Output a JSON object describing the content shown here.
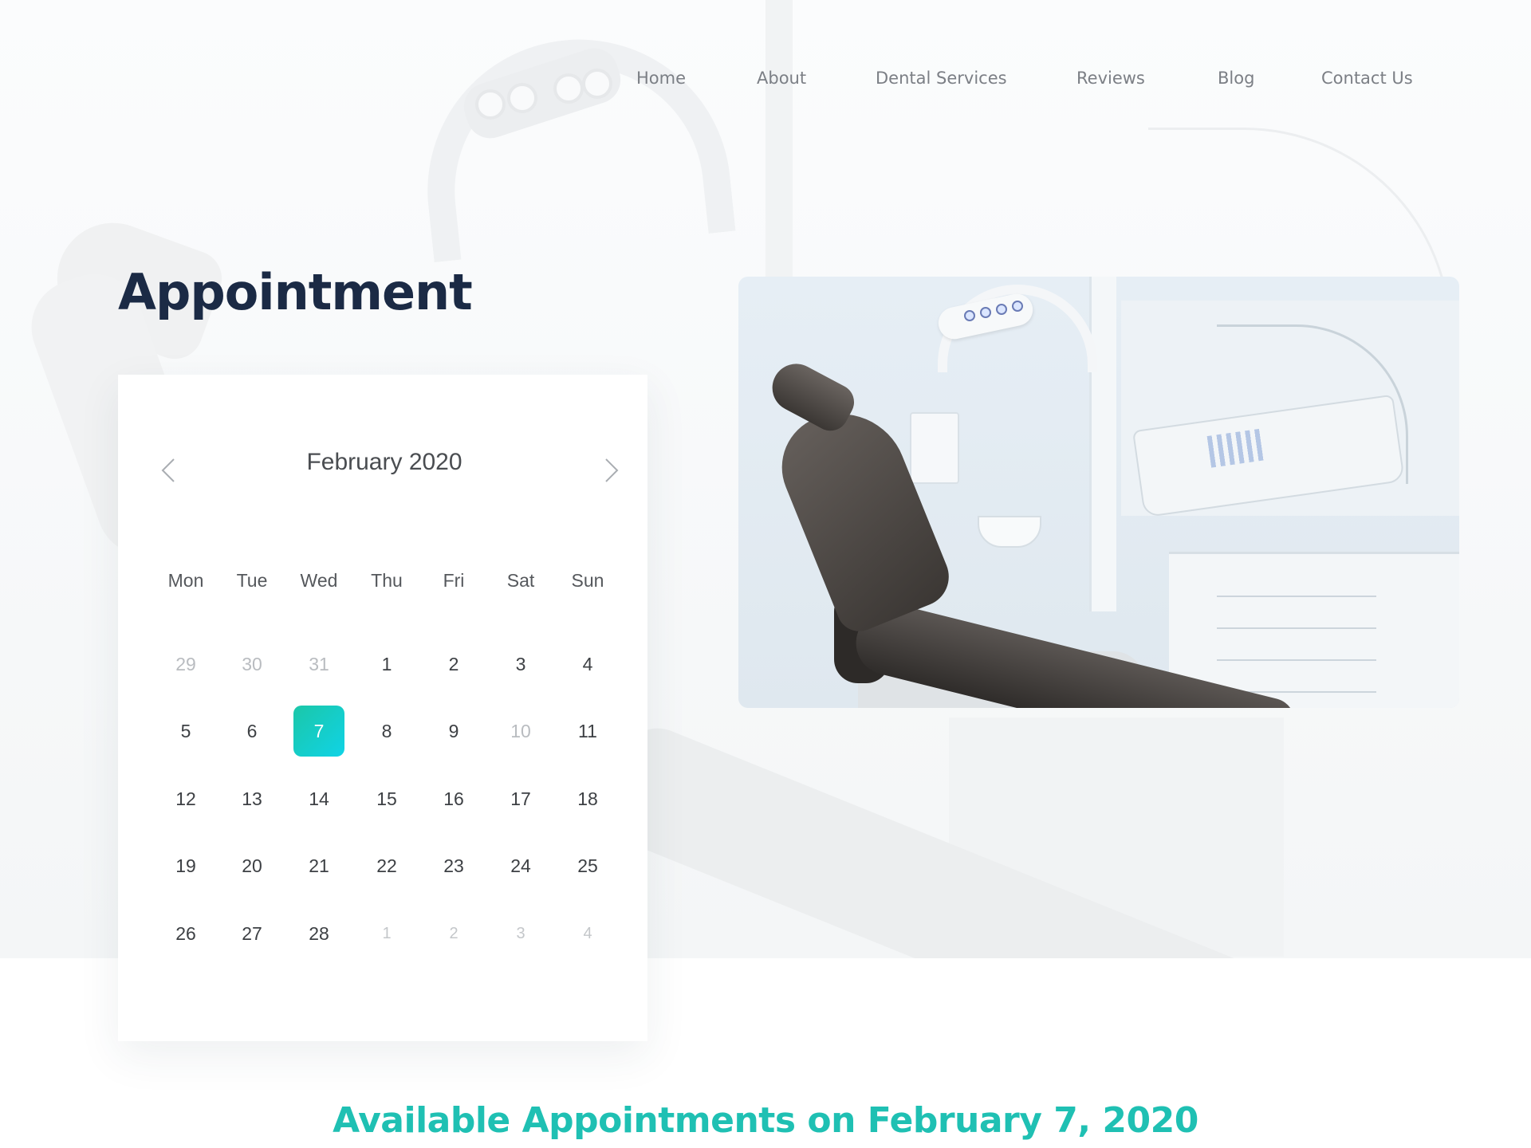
{
  "nav": {
    "items": [
      {
        "label": "Home"
      },
      {
        "label": "About"
      },
      {
        "label": "Dental Services"
      },
      {
        "label": "Reviews"
      },
      {
        "label": "Blog"
      },
      {
        "label": "Contact Us"
      }
    ]
  },
  "page_title": "Appointment",
  "calendar": {
    "month_label": "February 2020",
    "prev_icon": "chevron-left-icon",
    "next_icon": "chevron-right-icon",
    "weekdays": [
      "Mon",
      "Tue",
      "Wed",
      "Thu",
      "Fri",
      "Sat",
      "Sun"
    ],
    "weeks": [
      [
        {
          "d": "29",
          "muted": true
        },
        {
          "d": "30",
          "muted": true
        },
        {
          "d": "31",
          "muted": true
        },
        {
          "d": "1"
        },
        {
          "d": "2"
        },
        {
          "d": "3"
        },
        {
          "d": "4"
        }
      ],
      [
        {
          "d": "5"
        },
        {
          "d": "6"
        },
        {
          "d": "7",
          "selected": true
        },
        {
          "d": "8"
        },
        {
          "d": "9"
        },
        {
          "d": "10",
          "muted": true
        },
        {
          "d": "11"
        }
      ],
      [
        {
          "d": "12"
        },
        {
          "d": "13"
        },
        {
          "d": "14"
        },
        {
          "d": "15"
        },
        {
          "d": "16"
        },
        {
          "d": "17"
        },
        {
          "d": "18"
        }
      ],
      [
        {
          "d": "19"
        },
        {
          "d": "20"
        },
        {
          "d": "21"
        },
        {
          "d": "22"
        },
        {
          "d": "23"
        },
        {
          "d": "24"
        },
        {
          "d": "25"
        }
      ],
      [
        {
          "d": "26"
        },
        {
          "d": "27"
        },
        {
          "d": "28"
        },
        {
          "d": "1",
          "muted": true,
          "small": true
        },
        {
          "d": "2",
          "muted": true,
          "small": true
        },
        {
          "d": "3",
          "muted": true,
          "small": true
        },
        {
          "d": "4",
          "muted": true,
          "small": true
        }
      ]
    ],
    "selected_color": "#1bc7a8"
  },
  "available_heading": "Available Appointments on February 7, 2020",
  "colors": {
    "title": "#1b2a45",
    "accent": "#1fc0b3",
    "nav_text": "#7b7f85"
  }
}
